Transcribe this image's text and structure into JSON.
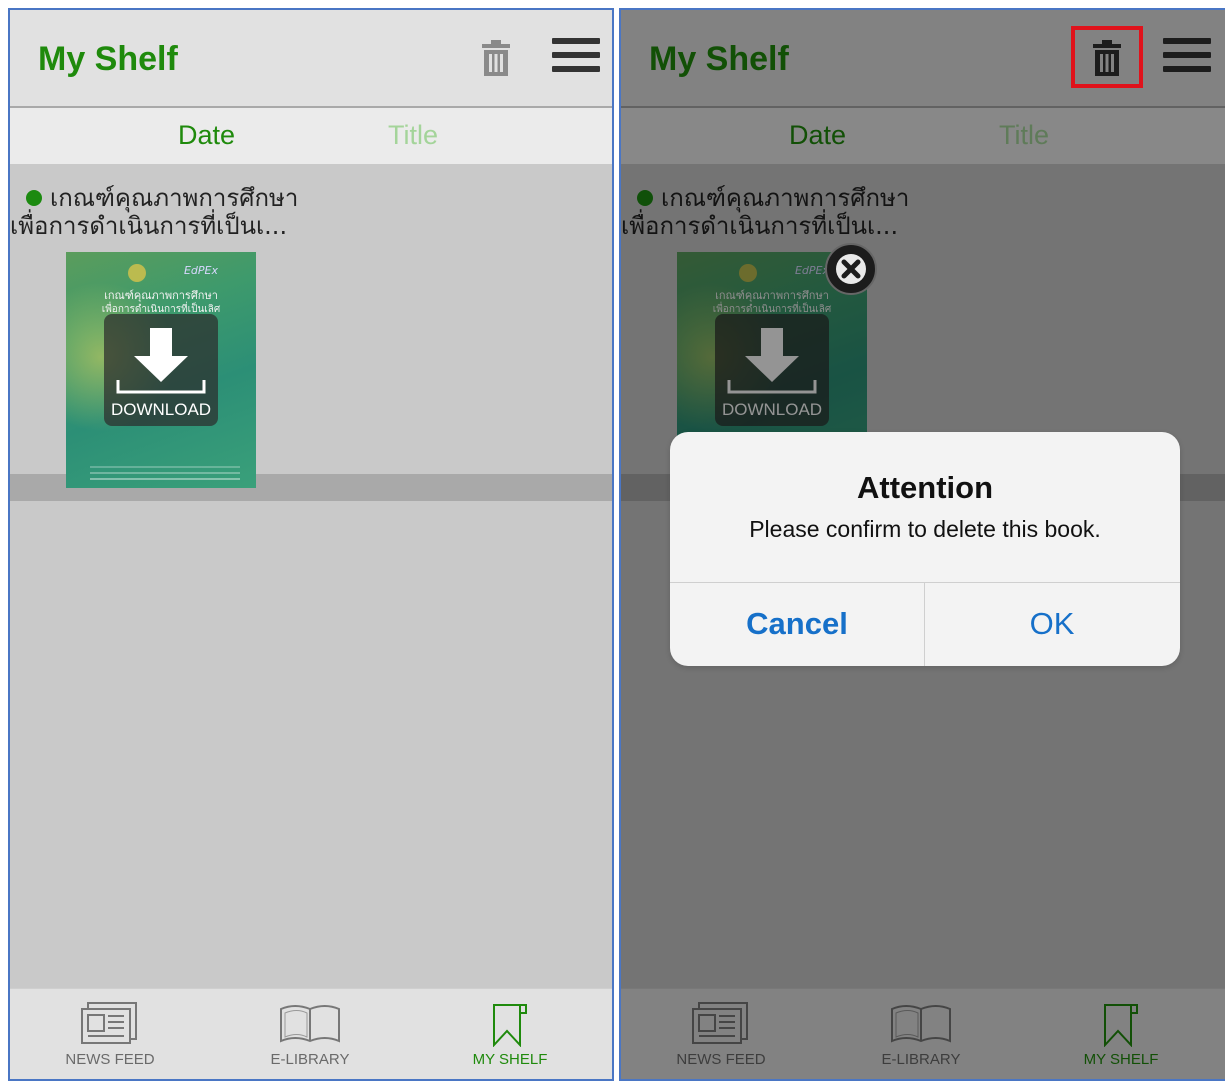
{
  "header": {
    "title": "My Shelf"
  },
  "sort_tabs": {
    "date": "Date",
    "title": "Title"
  },
  "book": {
    "title_line1": "เกณฑ์คุณภาพการศึกษา",
    "title_line2": "เพื่อการดำเนินการที่เป็นเ...",
    "cover_title_line1": "เกณฑ์คุณภาพการศึกษา",
    "cover_title_line2": "เพื่อการดำเนินการที่เป็นเลิศ",
    "cover_logo_text": "EdPEx",
    "download_label": "DOWNLOAD",
    "status_color": "#1c8a10"
  },
  "nav": {
    "items": [
      {
        "label": "NEWS FEED",
        "icon": "newspaper-icon"
      },
      {
        "label": "E-LIBRARY",
        "icon": "open-book-icon"
      },
      {
        "label": "MY SHELF",
        "icon": "bookmark-icon",
        "active": true
      }
    ]
  },
  "dialog": {
    "title": "Attention",
    "message": "Please confirm to delete this book.",
    "cancel_label": "Cancel",
    "ok_label": "OK"
  },
  "colors": {
    "brand_green": "#1f8a0c",
    "inactive_tab": "#a4d49a",
    "dialog_button": "#1670c9",
    "highlight": "#e0121b"
  }
}
